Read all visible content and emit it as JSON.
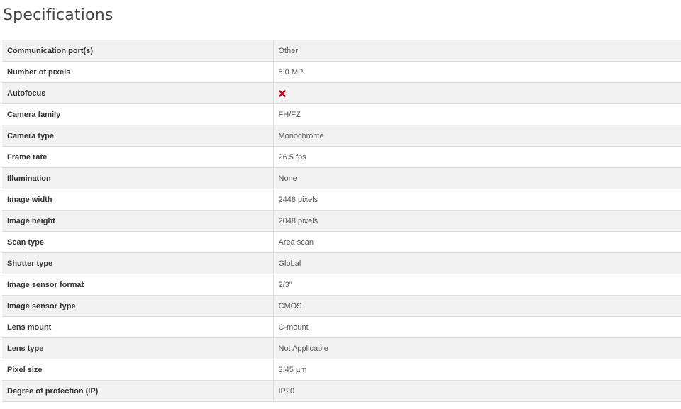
{
  "title": "Specifications",
  "colors": {
    "cross_icon": "#d0021b",
    "row_alt": "#f2f2f2",
    "border": "#dcdcdc"
  },
  "specs": [
    {
      "label": "Communication port(s)",
      "value": "Other"
    },
    {
      "label": "Number of pixels",
      "value": "5.0 MP"
    },
    {
      "label": "Autofocus",
      "value": "",
      "icon": "cross-icon"
    },
    {
      "label": "Camera family",
      "value": "FH/FZ"
    },
    {
      "label": "Camera type",
      "value": "Monochrome"
    },
    {
      "label": "Frame rate",
      "value": "26.5 fps"
    },
    {
      "label": "Illumination",
      "value": "None"
    },
    {
      "label": "Image width",
      "value": "2448 pixels"
    },
    {
      "label": "Image height",
      "value": "2048 pixels"
    },
    {
      "label": "Scan type",
      "value": "Area scan"
    },
    {
      "label": "Shutter type",
      "value": "Global"
    },
    {
      "label": "Image sensor format",
      "value": "2/3\""
    },
    {
      "label": "Image sensor type",
      "value": "CMOS"
    },
    {
      "label": "Lens mount",
      "value": "C-mount"
    },
    {
      "label": "Lens type",
      "value": "Not Applicable"
    },
    {
      "label": "Pixel size",
      "value": "3.45 µm"
    },
    {
      "label": "Degree of protection (IP)",
      "value": "IP20"
    }
  ]
}
